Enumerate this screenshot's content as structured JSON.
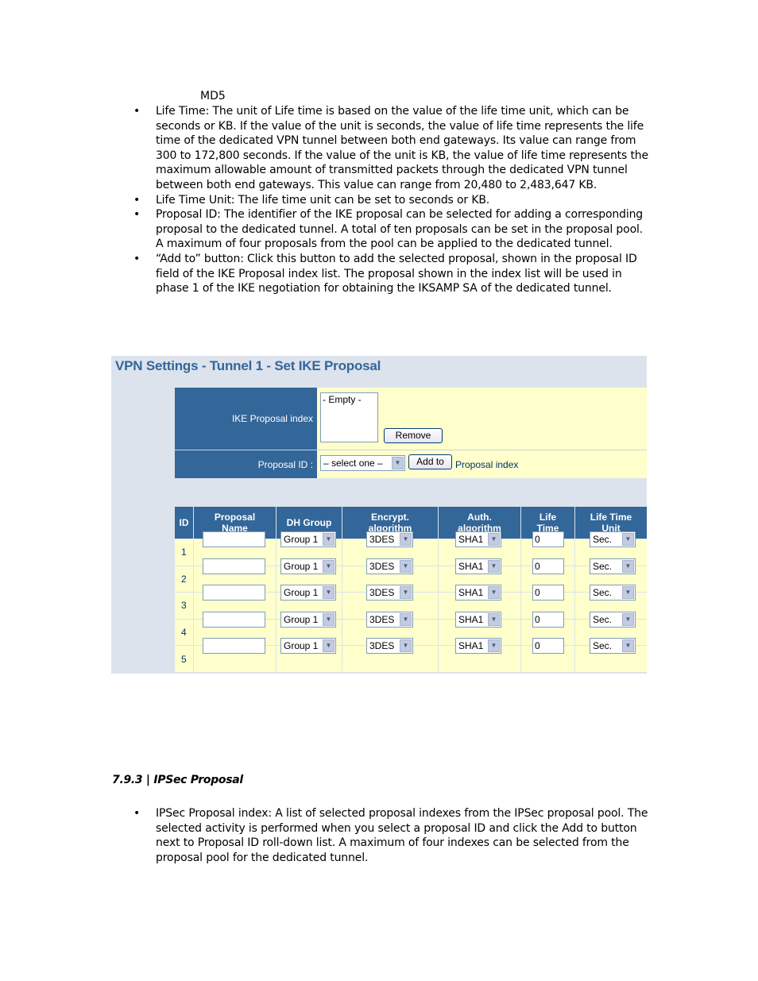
{
  "document": {
    "md5_line": "MD5",
    "bullets": [
      "Life Time: The unit of Life time is based on the value of the life time unit, which can be seconds or KB. If the value of the unit is seconds, the value of life time represents the life time of the dedicated VPN tunnel between both end gateways. Its value can range from 300 to 172,800 seconds. If the value of the unit is KB, the value of life time represents the maximum allowable amount of transmitted packets through the dedicated VPN tunnel between both end gateways. This value can range from 20,480 to 2,483,647 KB.",
      "Life Time Unit: The life time unit can be set to seconds or KB.",
      "Proposal ID: The identifier of the IKE proposal can be selected for adding a corresponding proposal to the dedicated tunnel. A total of ten proposals can be set in the proposal pool. A maximum of four proposals from the pool can be applied to the dedicated tunnel.",
      "“Add to” button: Click this button to add the selected proposal, shown in the proposal ID field of the IKE Proposal index list. The proposal shown in the index list will be used in phase 1 of the IKE negotiation for obtaining the IKSAMP SA of the dedicated tunnel."
    ],
    "bullet_glyph": "•",
    "section_heading": "7.9.3 | IPSec Proposal",
    "section_bullets": [
      "IPSec Proposal index: A list of selected proposal indexes from the IPSec proposal pool. The selected activity is performed when you select a proposal ID and click the Add to button next to Proposal ID roll-down list. A maximum of four indexes can be selected from the proposal pool for the dedicated tunnel."
    ]
  },
  "screenshot": {
    "title": "VPN Settings - Tunnel 1 - Set IKE Proposal",
    "ike_index_label": "IKE Proposal index",
    "ike_index_list": [
      "- Empty -"
    ],
    "remove_button": "Remove",
    "proposal_id_label": "Proposal ID :",
    "proposal_id_select": "– select one –",
    "add_to_button": "Add to",
    "proposal_index_link": "Proposal index",
    "colors": {
      "header_blue": "#336699",
      "cell_yellow": "#ffffcc",
      "frame_bg": "#dce3ec"
    },
    "table": {
      "headers": [
        "ID",
        "Proposal Name",
        "DH Group",
        "Encrypt. algorithm",
        "Auth. algorithm",
        "Life Time",
        "Life Time Unit"
      ],
      "rows": [
        {
          "id": "1",
          "name": "",
          "dh": "Group 1",
          "enc": "3DES",
          "auth": "SHA1",
          "life": "0",
          "unit": "Sec."
        },
        {
          "id": "2",
          "name": "",
          "dh": "Group 1",
          "enc": "3DES",
          "auth": "SHA1",
          "life": "0",
          "unit": "Sec."
        },
        {
          "id": "3",
          "name": "",
          "dh": "Group 1",
          "enc": "3DES",
          "auth": "SHA1",
          "life": "0",
          "unit": "Sec."
        },
        {
          "id": "4",
          "name": "",
          "dh": "Group 1",
          "enc": "3DES",
          "auth": "SHA1",
          "life": "0",
          "unit": "Sec."
        },
        {
          "id": "5",
          "name": "",
          "dh": "Group 1",
          "enc": "3DES",
          "auth": "SHA1",
          "life": "0",
          "unit": "Sec."
        }
      ]
    }
  }
}
